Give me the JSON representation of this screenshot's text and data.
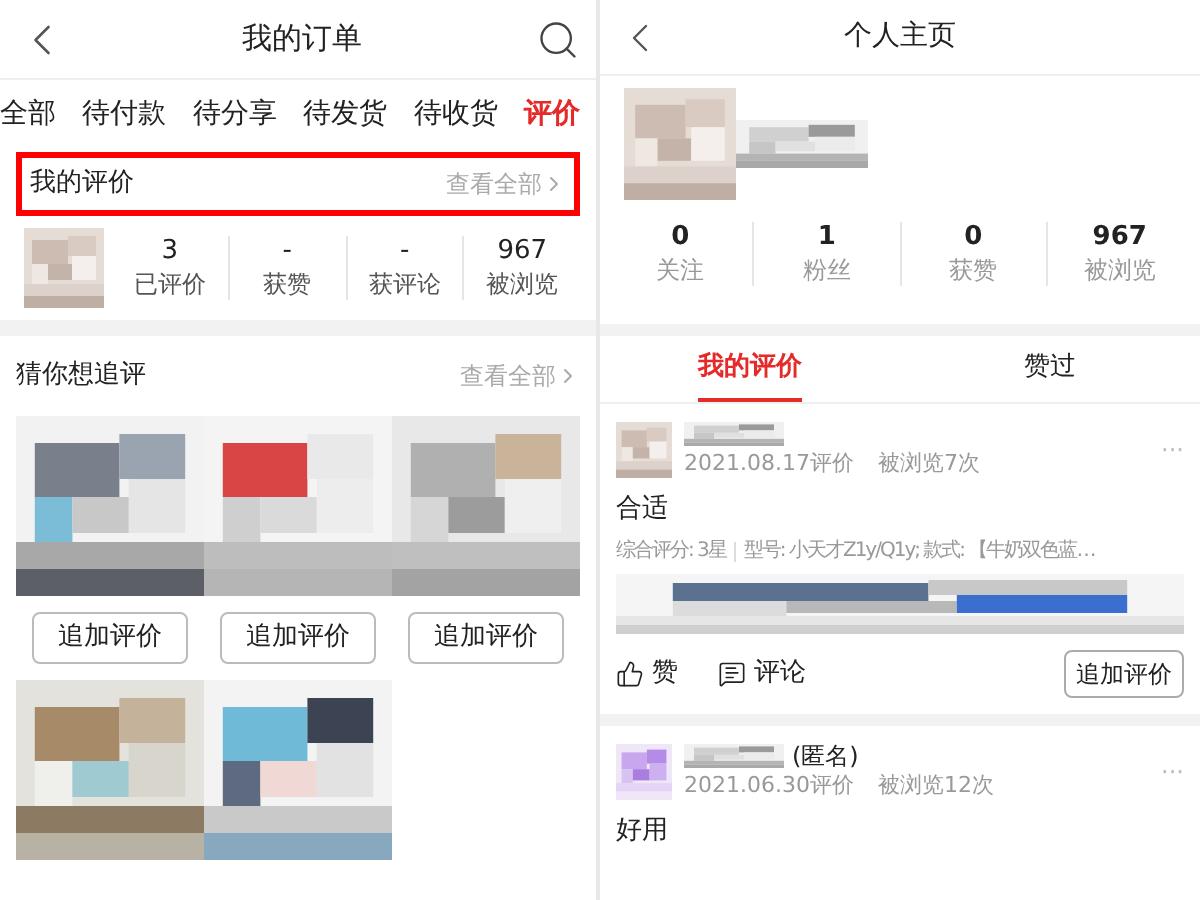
{
  "orders_screen": {
    "title": "我的订单",
    "tabs": [
      {
        "label": "全部",
        "selected": false
      },
      {
        "label": "待付款",
        "selected": false
      },
      {
        "label": "待分享",
        "selected": false
      },
      {
        "label": "待发货",
        "selected": false
      },
      {
        "label": "待收货",
        "selected": false
      },
      {
        "label": "评价",
        "selected": true
      }
    ],
    "my_reviews": {
      "title": "我的评价",
      "highlighted": true,
      "link": "查看全部",
      "stats": [
        {
          "value": "3",
          "label": "已评价"
        },
        {
          "value": "-",
          "label": "获赞"
        },
        {
          "value": "-",
          "label": "获评论"
        },
        {
          "value": "967",
          "label": "被浏览"
        }
      ]
    },
    "follow_up": {
      "title": "猜你想追评",
      "link": "查看全部",
      "products": [
        {
          "kind": "picture",
          "button": "追加评价"
        },
        {
          "kind": "picture",
          "button": "追加评价"
        },
        {
          "kind": "picture",
          "button": "追加评价"
        },
        {
          "kind": "picture"
        },
        {
          "kind": "picture"
        }
      ]
    }
  },
  "profile_screen": {
    "title": "个人主页",
    "stats": [
      {
        "value": "0",
        "label": "关注"
      },
      {
        "value": "1",
        "label": "粉丝"
      },
      {
        "value": "0",
        "label": "获赞"
      },
      {
        "value": "967",
        "label": "被浏览"
      }
    ],
    "tabs": [
      {
        "label": "我的评价",
        "selected": true
      },
      {
        "label": "赞过",
        "selected": false
      }
    ],
    "reviews": [
      {
        "date": "2021.08.17评价",
        "views": "被浏览7次",
        "more": "···",
        "text": "合适",
        "rating": "综合评分: 3星",
        "details": "型号: 小天才Z1y/Q1y; 款式: 【牛奶双色蓝…",
        "has_images": true,
        "like": "赞",
        "comment": "评论",
        "button": "追加评价"
      },
      {
        "name_suffix": "(匿名)",
        "date": "2021.06.30评价",
        "views": "被浏览12次",
        "more": "···",
        "text": "好用"
      }
    ]
  }
}
